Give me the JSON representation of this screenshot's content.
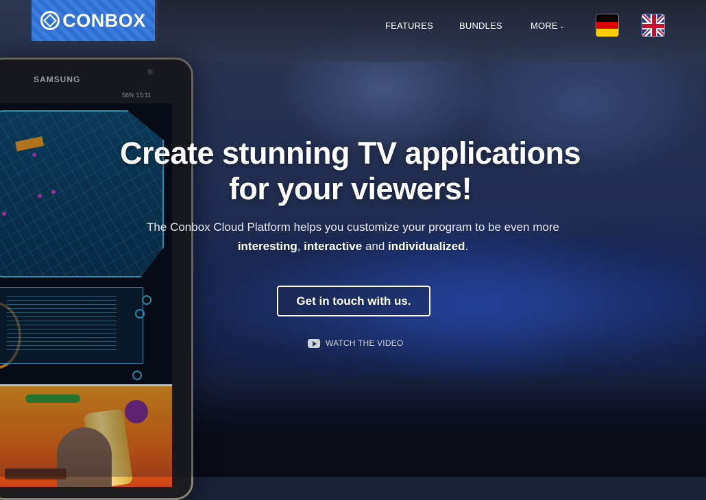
{
  "brand": {
    "name": "CONBOX",
    "accent": "#3374d6"
  },
  "nav": {
    "features": "FEATURES",
    "bundles": "BUNDLES",
    "more": "MORE",
    "more_icon": "chevron-down-icon"
  },
  "languages": [
    {
      "code": "de",
      "icon": "german-flag-icon"
    },
    {
      "code": "en",
      "icon": "uk-flag-icon"
    }
  ],
  "hero": {
    "title_line1": "Create stunning TV applications",
    "title_line2": "for your viewers!",
    "subtitle_start": "The Conbox Cloud Platform helps you customize your program to be even more ",
    "subtitle_bold1": "interesting",
    "subtitle_sep1": ", ",
    "subtitle_bold2": "interactive",
    "subtitle_sep2": " and ",
    "subtitle_bold3": "individualized",
    "subtitle_end": ".",
    "cta_label": "Get in touch with us.",
    "watch_label": "WATCH THE VIDEO",
    "watch_icon": "play-icon"
  },
  "device": {
    "brand": "SAMSUNG",
    "status": "56% 15:11"
  }
}
